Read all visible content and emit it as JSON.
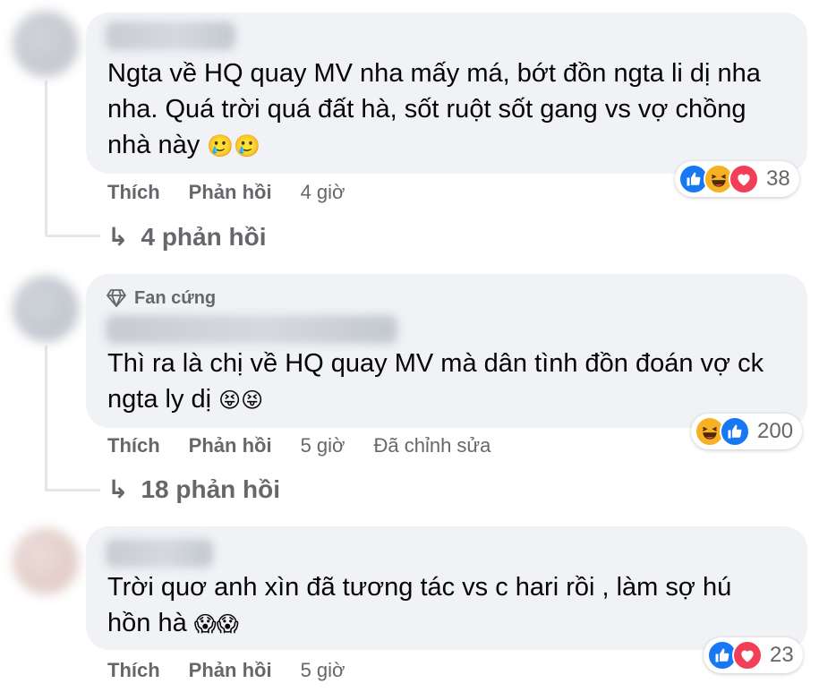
{
  "colors": {
    "bubble_bg": "#f0f2f5",
    "secondary_text": "#65676b",
    "like_blue": "#1877f2",
    "love_red": "#f33e58",
    "haha_yellow": "#f7b125"
  },
  "comments": [
    {
      "author_hidden": true,
      "text_lines": [
        "Ngta về HQ quay MV nha mấy má, bớt đồn ngta li dị nha",
        "nha. Quá trời quá đất hà, sốt ruột sốt gang vs vợ chồng",
        "nhà này"
      ],
      "emojis": "🥲🥲",
      "actions": {
        "like": "Thích",
        "reply": "Phản hồi",
        "time": "4 giờ"
      },
      "reactions": {
        "icons": [
          "like-icon",
          "haha-icon",
          "love-icon"
        ],
        "count": "38"
      },
      "replies_label": "4 phản hồi"
    },
    {
      "author_hidden": true,
      "badge": {
        "icon": "diamond-icon",
        "label": "Fan cứng"
      },
      "text_lines": [
        "Thì ra là chị về HQ quay MV mà dân tình đồn đoán vợ ck",
        "ngta ly dị"
      ],
      "emojis": "😝😝",
      "actions": {
        "like": "Thích",
        "reply": "Phản hồi",
        "time": "5 giờ",
        "edited": "Đã chỉnh sửa"
      },
      "reactions": {
        "icons": [
          "haha-icon",
          "like-icon"
        ],
        "count": "200"
      },
      "replies_label": "18 phản hồi"
    },
    {
      "author_hidden": true,
      "text_lines": [
        "Trời quơ anh xìn đã tương tác vs c hari rồi , làm sợ hú",
        "hồn hà"
      ],
      "emojis": "😱😱",
      "actions": {
        "like": "Thích",
        "reply": "Phản hồi",
        "time": "5 giờ"
      },
      "reactions": {
        "icons": [
          "like-icon",
          "love-icon"
        ],
        "count": "23"
      }
    }
  ]
}
